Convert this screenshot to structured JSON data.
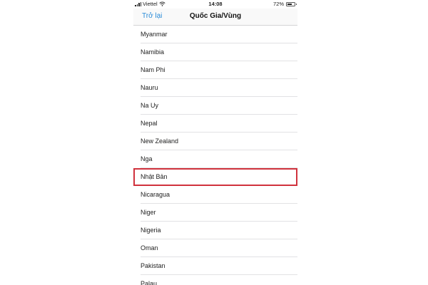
{
  "status_bar": {
    "carrier": "Viettel",
    "time": "14:08",
    "battery_percent": "72%",
    "battery_level": 0.72,
    "icons": [
      "signal-icon",
      "wifi-icon",
      "battery-icon"
    ]
  },
  "nav_bar": {
    "back_label": "Trở lại",
    "title": "Quốc Gia/Vùng",
    "accent_color": "#2a8bd8"
  },
  "countries": [
    {
      "label": "Myanmar"
    },
    {
      "label": "Namibia"
    },
    {
      "label": "Nam Phi"
    },
    {
      "label": "Nauru"
    },
    {
      "label": "Na Uy"
    },
    {
      "label": "Nepal"
    },
    {
      "label": "New Zealand"
    },
    {
      "label": "Nga"
    },
    {
      "label": "Nhật Bản",
      "highlighted": true
    },
    {
      "label": "Nicaragua"
    },
    {
      "label": "Niger"
    },
    {
      "label": "Nigeria"
    },
    {
      "label": "Oman"
    },
    {
      "label": "Pakistan"
    },
    {
      "label": "Palau"
    }
  ],
  "highlight_color": "#d0323d"
}
